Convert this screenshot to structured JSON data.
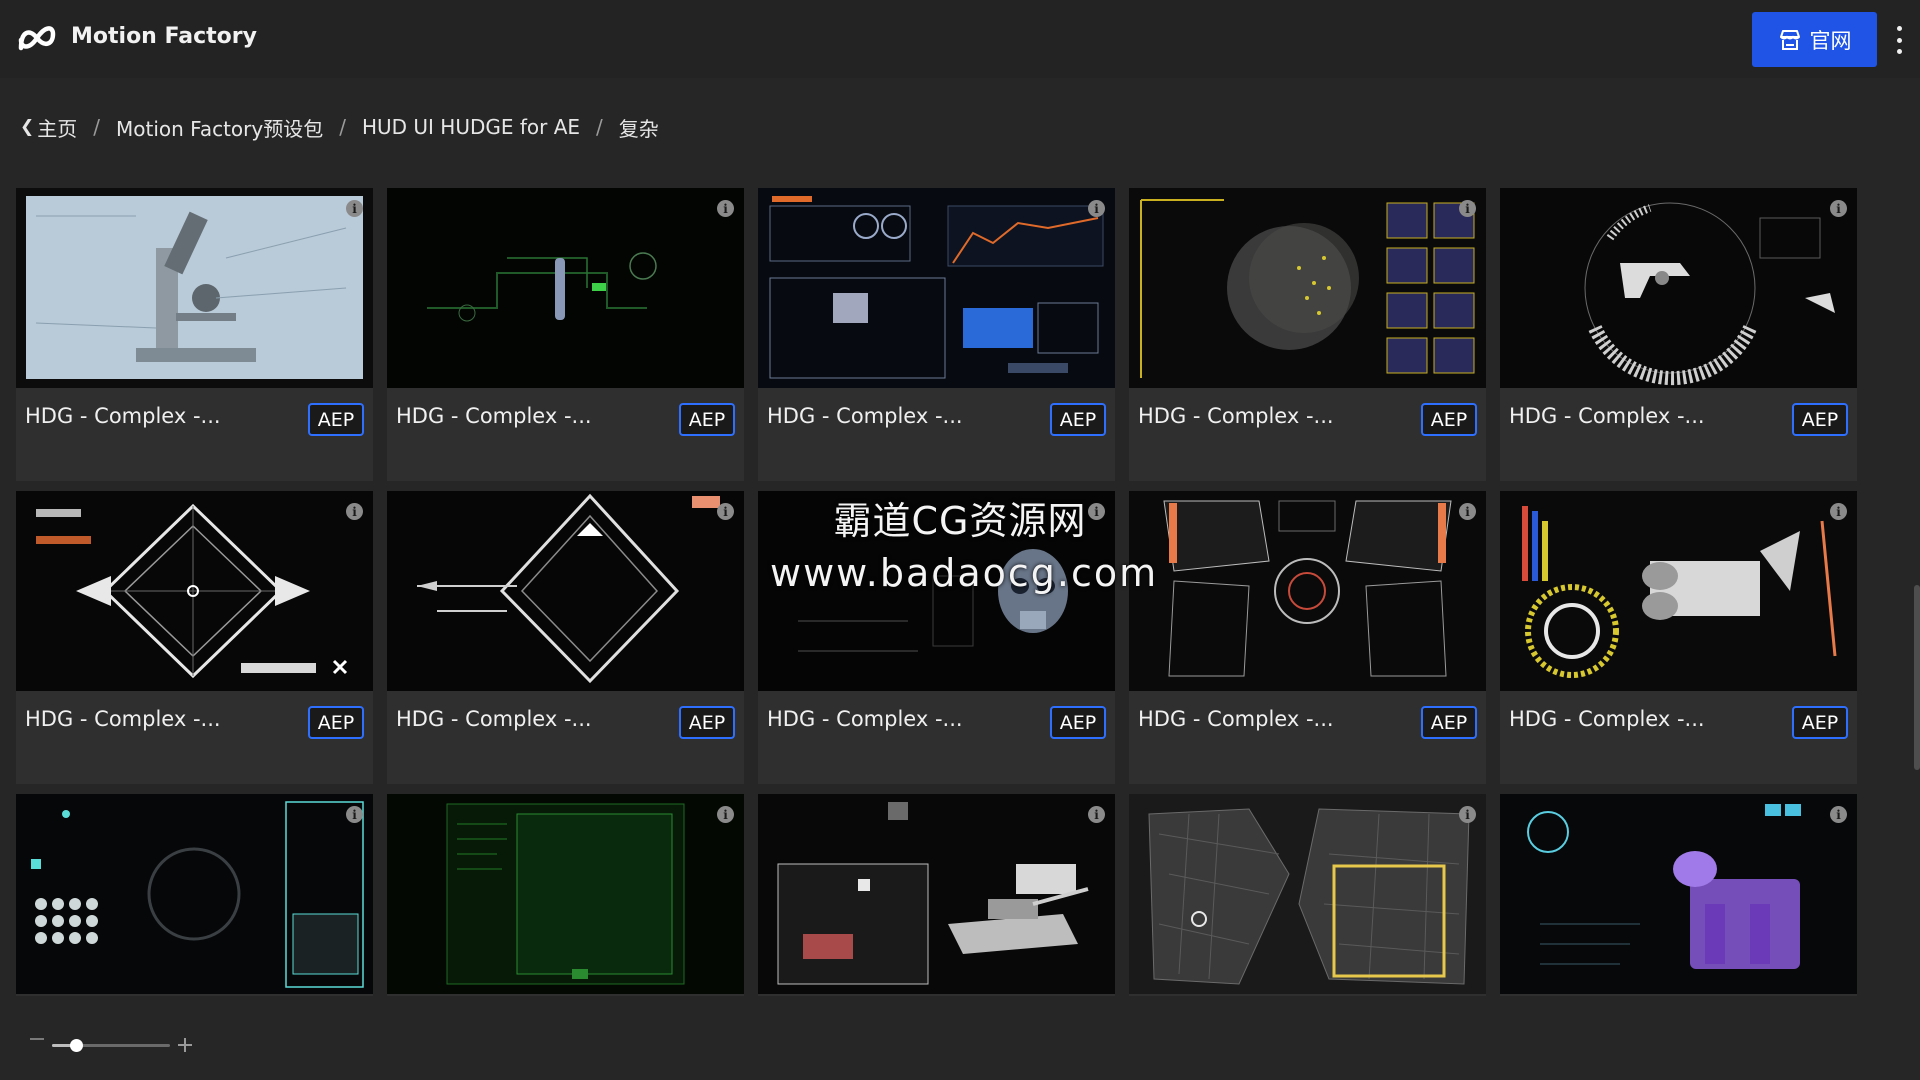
{
  "header": {
    "app_title": "Motion Factory",
    "site_button_label": "官网",
    "logo_icon": "motion-factory-logo",
    "store_icon": "storefront-icon",
    "menu_icon": "more-vertical-icon"
  },
  "breadcrumb": {
    "items": [
      "主页",
      "Motion Factory预设包",
      "HUD UI HUDGE for AE",
      "复杂"
    ],
    "separator": "/"
  },
  "cards": [
    {
      "title": "HDG - Complex -...",
      "badge": "AEP",
      "thumb": "microscope-diagram"
    },
    {
      "title": "HDG - Complex -...",
      "badge": "AEP",
      "thumb": "green-circuit"
    },
    {
      "title": "HDG - Complex -...",
      "badge": "AEP",
      "thumb": "hud-dashboard"
    },
    {
      "title": "HDG - Complex -...",
      "badge": "AEP",
      "thumb": "globe-panels"
    },
    {
      "title": "HDG - Complex -...",
      "badge": "AEP",
      "thumb": "revolver-radial"
    },
    {
      "title": "HDG - Complex -...",
      "badge": "AEP",
      "thumb": "milky-way-diamond"
    },
    {
      "title": "HDG - Complex -...",
      "badge": "AEP",
      "thumb": "diamond-frame"
    },
    {
      "title": "HDG - Complex -...",
      "badge": "AEP",
      "thumb": "skull-scan"
    },
    {
      "title": "HDG - Complex -...",
      "badge": "AEP",
      "thumb": "cockpit-grid"
    },
    {
      "title": "HDG - Complex -...",
      "badge": "AEP",
      "thumb": "engine-schematic"
    },
    {
      "title": "",
      "badge": "",
      "thumb": "optional-panel"
    },
    {
      "title": "",
      "badge": "",
      "thumb": "green-terminal"
    },
    {
      "title": "",
      "badge": "",
      "thumb": "tank-render"
    },
    {
      "title": "",
      "badge": "",
      "thumb": "city-map"
    },
    {
      "title": "",
      "badge": "",
      "thumb": "purple-machine"
    }
  ],
  "watermark": {
    "line1": "霸道CG资源网",
    "line2": "www.badaocg.com"
  },
  "zoom": {
    "level": 0.2
  },
  "colors": {
    "accent": "#1f54e6",
    "badge_border": "#2f6fff",
    "background": "#262626",
    "card": "#2f2f2f"
  }
}
